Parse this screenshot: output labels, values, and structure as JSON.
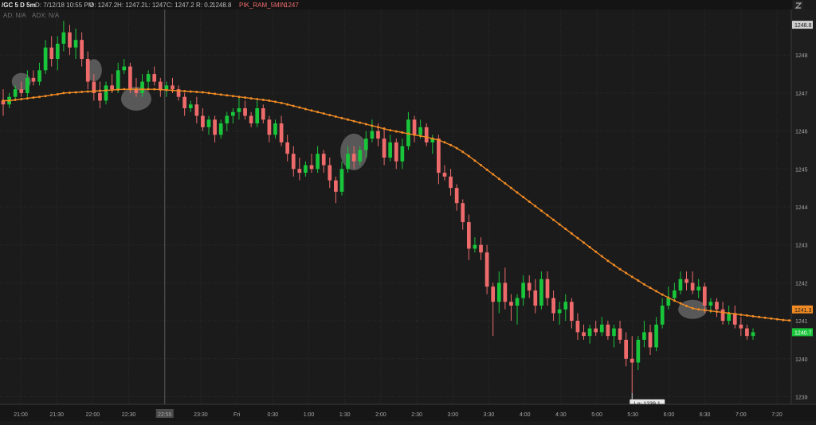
{
  "header": {
    "symbol": "/GC 5 D 5m",
    "date": "D: 7/12/18 10:55 PM",
    "open": "O: 1247.2",
    "high": "H: 1247.2",
    "low": "L: 1247",
    "close": "C: 1247.2",
    "range": "R: 0.2",
    "value": "1248.8",
    "study": "PIK_RAM_5MIN",
    "study_value": "1247",
    "ad_label": "AD: N/A",
    "adx_label": "ADX: N/A",
    "corner_icon": "zoom-icon"
  },
  "colors": {
    "background": "#1b1b1b",
    "up": "#19c53a",
    "down": "#ef6b6b",
    "ma": "#f08a24",
    "grid": "#2e2e2e",
    "highlight": "#8a8a8a"
  },
  "chart_data": {
    "type": "candlestick",
    "x_ticks": [
      "21:00",
      "21:30",
      "22:00",
      "22:30",
      "22:55",
      "23:30",
      "Fri",
      "0:30",
      "1:00",
      "1:30",
      "2:00",
      "2:30",
      "3:00",
      "3:30",
      "4:00",
      "4:30",
      "5:00",
      "5:30",
      "6:00",
      "6:30",
      "7:00",
      "7:20"
    ],
    "y_ticks": [
      1239,
      1240,
      1241,
      1242,
      1243,
      1244,
      1245,
      1246,
      1247,
      1248
    ],
    "ylim": [
      1238.8,
      1249.2
    ],
    "price_labels": {
      "top": "1248.8",
      "ma": "1241.3",
      "last": "1240.7"
    },
    "low_annotation": "Lo: 1239.1",
    "low_value": 1239.1,
    "ma_series_name": "",
    "candles": [
      {
        "o": 1246.8,
        "h": 1247.1,
        "l": 1246.4,
        "c": 1246.7
      },
      {
        "o": 1246.7,
        "h": 1247.0,
        "l": 1246.6,
        "c": 1246.9
      },
      {
        "o": 1246.9,
        "h": 1247.2,
        "l": 1246.8,
        "c": 1247.1
      },
      {
        "o": 1247.1,
        "h": 1247.3,
        "l": 1246.9,
        "c": 1247.0
      },
      {
        "o": 1247.0,
        "h": 1247.6,
        "l": 1246.9,
        "c": 1247.4
      },
      {
        "o": 1247.4,
        "h": 1247.6,
        "l": 1247.2,
        "c": 1247.3
      },
      {
        "o": 1247.3,
        "h": 1247.8,
        "l": 1247.2,
        "c": 1247.6
      },
      {
        "o": 1247.6,
        "h": 1248.4,
        "l": 1247.5,
        "c": 1248.2
      },
      {
        "o": 1248.2,
        "h": 1248.5,
        "l": 1247.7,
        "c": 1247.9
      },
      {
        "o": 1247.9,
        "h": 1248.5,
        "l": 1247.6,
        "c": 1248.3
      },
      {
        "o": 1248.3,
        "h": 1248.9,
        "l": 1248.1,
        "c": 1248.6
      },
      {
        "o": 1248.6,
        "h": 1248.8,
        "l": 1248.0,
        "c": 1248.2
      },
      {
        "o": 1248.2,
        "h": 1248.7,
        "l": 1247.9,
        "c": 1248.4
      },
      {
        "o": 1248.4,
        "h": 1248.6,
        "l": 1247.7,
        "c": 1247.9
      },
      {
        "o": 1247.9,
        "h": 1248.1,
        "l": 1247.1,
        "c": 1247.3
      },
      {
        "o": 1247.3,
        "h": 1247.5,
        "l": 1246.8,
        "c": 1247.0
      },
      {
        "o": 1247.0,
        "h": 1247.3,
        "l": 1246.6,
        "c": 1246.8
      },
      {
        "o": 1246.8,
        "h": 1247.3,
        "l": 1246.7,
        "c": 1247.2
      },
      {
        "o": 1247.2,
        "h": 1247.5,
        "l": 1247.0,
        "c": 1247.1
      },
      {
        "o": 1247.1,
        "h": 1247.8,
        "l": 1247.0,
        "c": 1247.6
      },
      {
        "o": 1247.6,
        "h": 1247.9,
        "l": 1247.5,
        "c": 1247.7
      },
      {
        "o": 1247.7,
        "h": 1247.8,
        "l": 1247.0,
        "c": 1247.1
      },
      {
        "o": 1247.1,
        "h": 1247.4,
        "l": 1246.9,
        "c": 1247.0
      },
      {
        "o": 1247.0,
        "h": 1247.5,
        "l": 1246.9,
        "c": 1247.3
      },
      {
        "o": 1247.3,
        "h": 1247.6,
        "l": 1247.1,
        "c": 1247.5
      },
      {
        "o": 1247.5,
        "h": 1247.7,
        "l": 1247.2,
        "c": 1247.3
      },
      {
        "o": 1247.3,
        "h": 1247.4,
        "l": 1246.9,
        "c": 1247.1
      },
      {
        "o": 1247.1,
        "h": 1247.3,
        "l": 1246.9,
        "c": 1247.2
      },
      {
        "o": 1247.2,
        "h": 1247.4,
        "l": 1247.0,
        "c": 1247.1
      },
      {
        "o": 1247.1,
        "h": 1247.2,
        "l": 1246.8,
        "c": 1246.9
      },
      {
        "o": 1246.9,
        "h": 1247.0,
        "l": 1246.4,
        "c": 1246.6
      },
      {
        "o": 1246.6,
        "h": 1246.8,
        "l": 1246.5,
        "c": 1246.7
      },
      {
        "o": 1246.7,
        "h": 1246.9,
        "l": 1246.2,
        "c": 1246.4
      },
      {
        "o": 1246.4,
        "h": 1246.6,
        "l": 1246.0,
        "c": 1246.1
      },
      {
        "o": 1246.1,
        "h": 1246.4,
        "l": 1245.9,
        "c": 1246.3
      },
      {
        "o": 1246.3,
        "h": 1246.4,
        "l": 1245.7,
        "c": 1245.9
      },
      {
        "o": 1245.9,
        "h": 1246.3,
        "l": 1245.8,
        "c": 1246.2
      },
      {
        "o": 1246.2,
        "h": 1246.5,
        "l": 1246.0,
        "c": 1246.4
      },
      {
        "o": 1246.4,
        "h": 1246.6,
        "l": 1246.2,
        "c": 1246.5
      },
      {
        "o": 1246.5,
        "h": 1246.9,
        "l": 1246.3,
        "c": 1246.6
      },
      {
        "o": 1246.6,
        "h": 1246.8,
        "l": 1246.3,
        "c": 1246.4
      },
      {
        "o": 1246.4,
        "h": 1246.5,
        "l": 1246.1,
        "c": 1246.2
      },
      {
        "o": 1246.2,
        "h": 1246.8,
        "l": 1246.1,
        "c": 1246.6
      },
      {
        "o": 1246.6,
        "h": 1246.7,
        "l": 1246.2,
        "c": 1246.3
      },
      {
        "o": 1246.3,
        "h": 1246.4,
        "l": 1245.7,
        "c": 1245.9
      },
      {
        "o": 1245.9,
        "h": 1246.3,
        "l": 1245.8,
        "c": 1246.2
      },
      {
        "o": 1246.2,
        "h": 1246.4,
        "l": 1245.6,
        "c": 1245.7
      },
      {
        "o": 1245.7,
        "h": 1245.9,
        "l": 1245.2,
        "c": 1245.4
      },
      {
        "o": 1245.4,
        "h": 1245.6,
        "l": 1244.8,
        "c": 1245.0
      },
      {
        "o": 1245.0,
        "h": 1245.3,
        "l": 1244.7,
        "c": 1244.9
      },
      {
        "o": 1244.9,
        "h": 1245.2,
        "l": 1244.8,
        "c": 1245.1
      },
      {
        "o": 1245.1,
        "h": 1245.4,
        "l": 1244.9,
        "c": 1245.0
      },
      {
        "o": 1245.0,
        "h": 1245.6,
        "l": 1244.9,
        "c": 1245.4
      },
      {
        "o": 1245.4,
        "h": 1245.5,
        "l": 1244.9,
        "c": 1245.1
      },
      {
        "o": 1245.1,
        "h": 1245.3,
        "l": 1244.5,
        "c": 1244.7
      },
      {
        "o": 1244.7,
        "h": 1244.8,
        "l": 1244.1,
        "c": 1244.4
      },
      {
        "o": 1244.4,
        "h": 1245.2,
        "l": 1244.3,
        "c": 1245.0
      },
      {
        "o": 1245.0,
        "h": 1245.6,
        "l": 1244.9,
        "c": 1245.4
      },
      {
        "o": 1245.4,
        "h": 1245.6,
        "l": 1245.0,
        "c": 1245.2
      },
      {
        "o": 1245.2,
        "h": 1245.6,
        "l": 1245.1,
        "c": 1245.5
      },
      {
        "o": 1245.5,
        "h": 1246.0,
        "l": 1245.3,
        "c": 1245.8
      },
      {
        "o": 1245.8,
        "h": 1246.3,
        "l": 1245.7,
        "c": 1246.0
      },
      {
        "o": 1246.0,
        "h": 1246.2,
        "l": 1245.6,
        "c": 1245.8
      },
      {
        "o": 1245.8,
        "h": 1246.1,
        "l": 1245.1,
        "c": 1245.3
      },
      {
        "o": 1245.3,
        "h": 1245.9,
        "l": 1245.2,
        "c": 1245.7
      },
      {
        "o": 1245.7,
        "h": 1245.8,
        "l": 1245.0,
        "c": 1245.2
      },
      {
        "o": 1245.2,
        "h": 1245.8,
        "l": 1245.0,
        "c": 1245.6
      },
      {
        "o": 1245.6,
        "h": 1246.5,
        "l": 1245.5,
        "c": 1246.3
      },
      {
        "o": 1246.3,
        "h": 1246.4,
        "l": 1245.7,
        "c": 1245.9
      },
      {
        "o": 1245.9,
        "h": 1246.3,
        "l": 1245.8,
        "c": 1246.1
      },
      {
        "o": 1246.1,
        "h": 1246.2,
        "l": 1245.6,
        "c": 1245.7
      },
      {
        "o": 1245.7,
        "h": 1245.9,
        "l": 1245.4,
        "c": 1245.8
      },
      {
        "o": 1245.8,
        "h": 1245.9,
        "l": 1244.6,
        "c": 1244.9
      },
      {
        "o": 1244.9,
        "h": 1245.1,
        "l": 1244.7,
        "c": 1244.8
      },
      {
        "o": 1244.8,
        "h": 1245.0,
        "l": 1244.3,
        "c": 1244.5
      },
      {
        "o": 1244.5,
        "h": 1244.6,
        "l": 1243.9,
        "c": 1244.1
      },
      {
        "o": 1244.1,
        "h": 1244.2,
        "l": 1243.4,
        "c": 1243.6
      },
      {
        "o": 1243.6,
        "h": 1243.8,
        "l": 1242.6,
        "c": 1242.9
      },
      {
        "o": 1242.9,
        "h": 1243.2,
        "l": 1242.8,
        "c": 1243.0
      },
      {
        "o": 1243.0,
        "h": 1243.2,
        "l": 1242.6,
        "c": 1242.8
      },
      {
        "o": 1242.8,
        "h": 1243.0,
        "l": 1241.7,
        "c": 1241.9
      },
      {
        "o": 1241.9,
        "h": 1242.0,
        "l": 1240.6,
        "c": 1241.5
      },
      {
        "o": 1241.5,
        "h": 1242.3,
        "l": 1241.2,
        "c": 1242.0
      },
      {
        "o": 1242.0,
        "h": 1242.4,
        "l": 1241.3,
        "c": 1241.5
      },
      {
        "o": 1241.5,
        "h": 1241.7,
        "l": 1241.0,
        "c": 1241.4
      },
      {
        "o": 1241.4,
        "h": 1241.7,
        "l": 1240.9,
        "c": 1241.6
      },
      {
        "o": 1241.6,
        "h": 1242.2,
        "l": 1241.4,
        "c": 1242.0
      },
      {
        "o": 1242.0,
        "h": 1242.2,
        "l": 1241.6,
        "c": 1241.8
      },
      {
        "o": 1241.8,
        "h": 1242.1,
        "l": 1241.2,
        "c": 1241.4
      },
      {
        "o": 1241.4,
        "h": 1242.3,
        "l": 1241.3,
        "c": 1242.1
      },
      {
        "o": 1242.1,
        "h": 1242.3,
        "l": 1241.4,
        "c": 1241.6
      },
      {
        "o": 1241.6,
        "h": 1241.8,
        "l": 1241.0,
        "c": 1241.2
      },
      {
        "o": 1241.2,
        "h": 1241.5,
        "l": 1240.9,
        "c": 1241.3
      },
      {
        "o": 1241.3,
        "h": 1241.7,
        "l": 1241.0,
        "c": 1241.5
      },
      {
        "o": 1241.5,
        "h": 1241.6,
        "l": 1240.8,
        "c": 1241.0
      },
      {
        "o": 1241.0,
        "h": 1241.2,
        "l": 1240.5,
        "c": 1240.7
      },
      {
        "o": 1240.7,
        "h": 1240.9,
        "l": 1240.5,
        "c": 1240.6
      },
      {
        "o": 1240.6,
        "h": 1240.9,
        "l": 1240.4,
        "c": 1240.8
      },
      {
        "o": 1240.8,
        "h": 1241.0,
        "l": 1240.6,
        "c": 1240.7
      },
      {
        "o": 1240.7,
        "h": 1241.1,
        "l": 1240.6,
        "c": 1240.9
      },
      {
        "o": 1240.9,
        "h": 1241.0,
        "l": 1240.5,
        "c": 1240.6
      },
      {
        "o": 1240.6,
        "h": 1240.9,
        "l": 1240.3,
        "c": 1240.8
      },
      {
        "o": 1240.8,
        "h": 1241.0,
        "l": 1240.4,
        "c": 1240.5
      },
      {
        "o": 1240.5,
        "h": 1240.7,
        "l": 1239.8,
        "c": 1240.0
      },
      {
        "o": 1240.0,
        "h": 1240.6,
        "l": 1239.1,
        "c": 1239.9
      },
      {
        "o": 1239.9,
        "h": 1240.6,
        "l": 1239.7,
        "c": 1240.5
      },
      {
        "o": 1240.5,
        "h": 1241.0,
        "l": 1240.3,
        "c": 1240.7
      },
      {
        "o": 1240.7,
        "h": 1240.9,
        "l": 1240.1,
        "c": 1240.3
      },
      {
        "o": 1240.3,
        "h": 1241.1,
        "l": 1240.2,
        "c": 1240.9
      },
      {
        "o": 1240.9,
        "h": 1241.6,
        "l": 1240.8,
        "c": 1241.4
      },
      {
        "o": 1241.4,
        "h": 1241.9,
        "l": 1241.3,
        "c": 1241.6
      },
      {
        "o": 1241.6,
        "h": 1242.0,
        "l": 1241.5,
        "c": 1241.8
      },
      {
        "o": 1241.8,
        "h": 1242.3,
        "l": 1241.7,
        "c": 1242.1
      },
      {
        "o": 1242.1,
        "h": 1242.3,
        "l": 1241.8,
        "c": 1242.0
      },
      {
        "o": 1242.0,
        "h": 1242.3,
        "l": 1241.7,
        "c": 1241.8
      },
      {
        "o": 1241.8,
        "h": 1242.1,
        "l": 1241.6,
        "c": 1241.9
      },
      {
        "o": 1241.9,
        "h": 1242.0,
        "l": 1241.2,
        "c": 1241.4
      },
      {
        "o": 1241.4,
        "h": 1241.6,
        "l": 1241.2,
        "c": 1241.5
      },
      {
        "o": 1241.5,
        "h": 1241.6,
        "l": 1241.1,
        "c": 1241.3
      },
      {
        "o": 1241.3,
        "h": 1241.5,
        "l": 1240.9,
        "c": 1241.0
      },
      {
        "o": 1241.0,
        "h": 1241.4,
        "l": 1240.9,
        "c": 1241.2
      },
      {
        "o": 1241.2,
        "h": 1241.4,
        "l": 1240.8,
        "c": 1240.9
      },
      {
        "o": 1240.9,
        "h": 1241.1,
        "l": 1240.6,
        "c": 1240.8
      },
      {
        "o": 1240.8,
        "h": 1240.9,
        "l": 1240.5,
        "c": 1240.6
      },
      {
        "o": 1240.6,
        "h": 1240.8,
        "l": 1240.5,
        "c": 1240.7
      }
    ],
    "ma": [
      1246.8,
      1246.8,
      1246.82,
      1246.84,
      1246.86,
      1246.88,
      1246.9,
      1246.92,
      1246.95,
      1246.97,
      1247.0,
      1247.01,
      1247.02,
      1247.03,
      1247.04,
      1247.05,
      1247.06,
      1247.07,
      1247.08,
      1247.09,
      1247.1,
      1247.1,
      1247.1,
      1247.1,
      1247.1,
      1247.1,
      1247.09,
      1247.08,
      1247.07,
      1247.06,
      1247.05,
      1247.04,
      1247.03,
      1247.02,
      1247.0,
      1246.98,
      1246.96,
      1246.94,
      1246.92,
      1246.9,
      1246.88,
      1246.86,
      1246.84,
      1246.82,
      1246.8,
      1246.77,
      1246.74,
      1246.7,
      1246.66,
      1246.62,
      1246.58,
      1246.54,
      1246.5,
      1246.46,
      1246.42,
      1246.38,
      1246.34,
      1246.3,
      1246.26,
      1246.22,
      1246.18,
      1246.14,
      1246.1,
      1246.06,
      1246.02,
      1245.99,
      1245.96,
      1245.93,
      1245.9,
      1245.87,
      1245.84,
      1245.8,
      1245.76,
      1245.7,
      1245.63,
      1245.55,
      1245.45,
      1245.34,
      1245.22,
      1245.1,
      1244.98,
      1244.86,
      1244.74,
      1244.62,
      1244.5,
      1244.38,
      1244.26,
      1244.14,
      1244.02,
      1243.9,
      1243.78,
      1243.66,
      1243.54,
      1243.42,
      1243.3,
      1243.18,
      1243.06,
      1242.94,
      1242.82,
      1242.7,
      1242.58,
      1242.47,
      1242.36,
      1242.26,
      1242.16,
      1242.06,
      1241.96,
      1241.87,
      1241.78,
      1241.69,
      1241.61,
      1241.53,
      1241.46,
      1241.39,
      1241.33,
      1241.3,
      1241.28,
      1241.26,
      1241.24,
      1241.22,
      1241.2,
      1241.18,
      1241.16,
      1241.14,
      1241.12,
      1241.1,
      1241.08,
      1241.06,
      1241.04,
      1241.02,
      1241.01,
      1241.0,
      1241.0,
      1241.0
    ]
  }
}
